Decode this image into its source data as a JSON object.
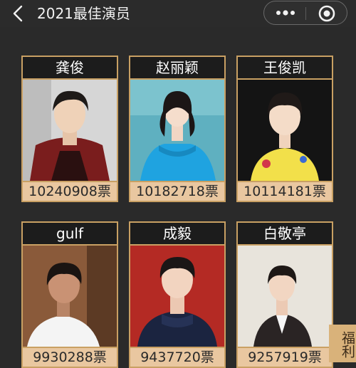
{
  "header": {
    "title": "2021最佳演员"
  },
  "icons": {
    "back": "back-chevron-icon",
    "more": "more-dots-icon",
    "close": "target-circle-icon"
  },
  "actors": [
    {
      "name": "龚俊",
      "votes": "10240908票",
      "bg": "#d6d6d6",
      "outfit": "#7a1d1d"
    },
    {
      "name": "赵丽颖",
      "votes": "10182718票",
      "bg": "#5fb0c0",
      "outfit": "#1fa3e0"
    },
    {
      "name": "王俊凯",
      "votes": "10114181票",
      "bg": "#141414",
      "outfit": "#f2e04a"
    },
    {
      "name": "gulf",
      "votes": "9930288票",
      "bg": "#8a5a3a",
      "outfit": "#f4f4f4"
    },
    {
      "name": "成毅",
      "votes": "9437720票",
      "bg": "#b42a24",
      "outfit": "#1b2440"
    },
    {
      "name": "白敬亭",
      "votes": "9257919票",
      "bg": "#e8e4dc",
      "outfit": "#2a2424"
    }
  ],
  "side_tab": {
    "label": "福利"
  },
  "colors": {
    "accent": "#c9a063",
    "vote_bg": "#e9c7a0",
    "page_bg": "#2a2a2a"
  }
}
